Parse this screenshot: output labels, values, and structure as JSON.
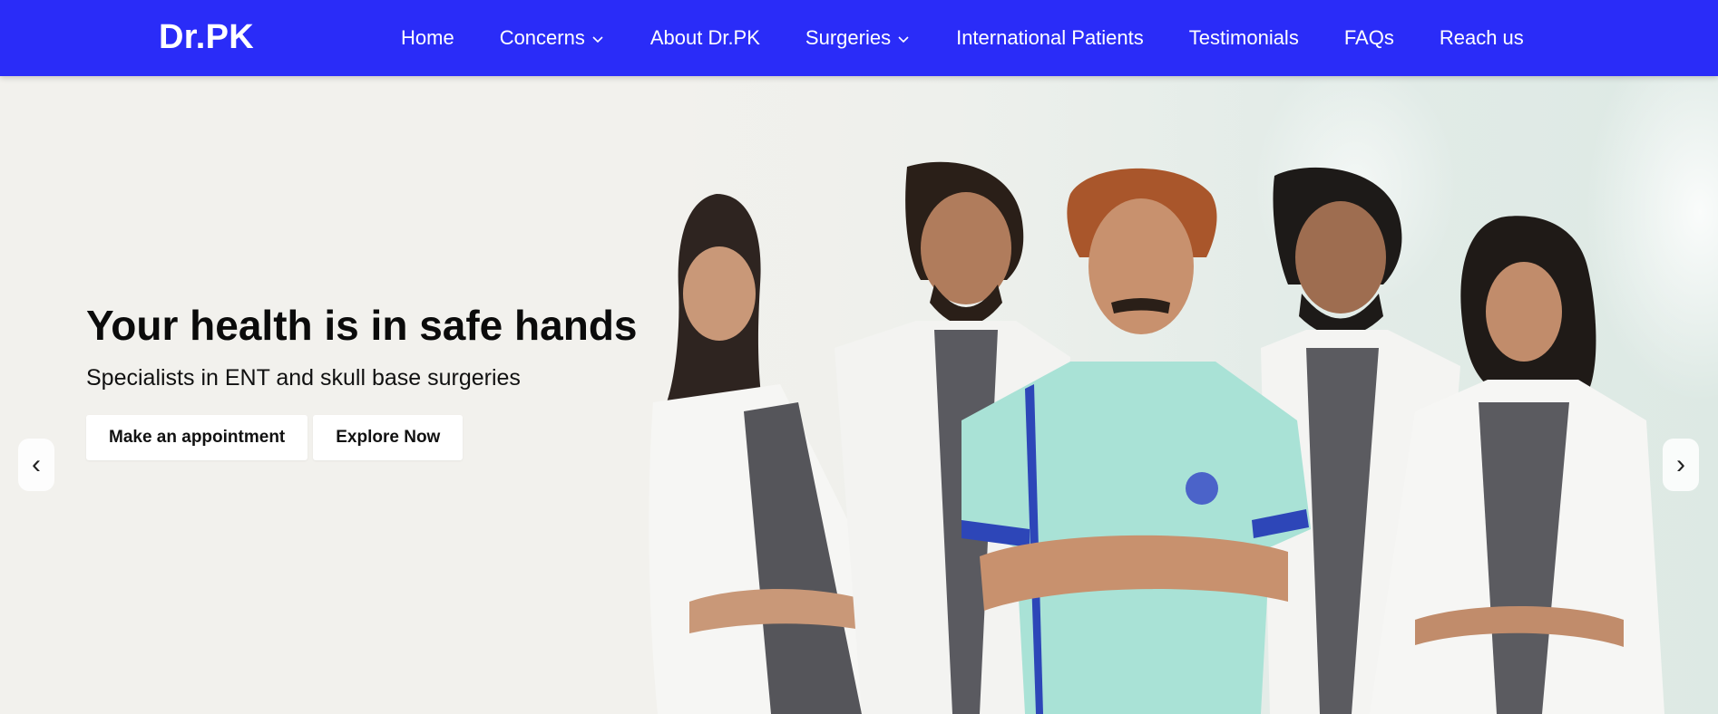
{
  "brand": {
    "logo_text": "Dr.PK",
    "nav_color": "#2a2cf8"
  },
  "nav": {
    "items": [
      {
        "label": "Home",
        "has_dropdown": false
      },
      {
        "label": "Concerns",
        "has_dropdown": true
      },
      {
        "label": "About Dr.PK",
        "has_dropdown": false
      },
      {
        "label": "Surgeries",
        "has_dropdown": true
      },
      {
        "label": "International Patients",
        "has_dropdown": false
      },
      {
        "label": "Testimonials",
        "has_dropdown": false
      },
      {
        "label": "FAQs",
        "has_dropdown": false
      },
      {
        "label": "Reach us",
        "has_dropdown": false
      }
    ]
  },
  "hero": {
    "title": "Your health is in safe hands",
    "subtitle": "Specialists in ENT and skull base surgeries",
    "primary_button": "Make an appointment",
    "secondary_button": "Explore Now",
    "prev_arrow": "‹",
    "next_arrow": "›",
    "image_icon": "team-of-doctors-photo"
  }
}
